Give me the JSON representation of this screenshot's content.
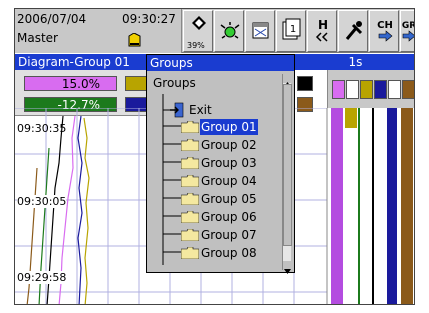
{
  "status": {
    "date": "2006/07/04",
    "time": "09:30:27",
    "user": "Master",
    "memory_percent": "39%"
  },
  "toolbar": {
    "buttons": [
      {
        "name": "display-switch-icon"
      },
      {
        "name": "alarm-icon"
      },
      {
        "name": "calendar-icon"
      },
      {
        "name": "screen-number-icon",
        "label": "1"
      },
      {
        "name": "history-icon",
        "label": "H"
      },
      {
        "name": "tools-icon"
      },
      {
        "name": "channel-icon",
        "label": "CH"
      },
      {
        "name": "group-icon",
        "label": "GR"
      }
    ]
  },
  "header": {
    "group_title": "Diagram-Group 01",
    "interval": "1s"
  },
  "values": [
    {
      "text": "15.0%"
    },
    {
      "text": "-12.7%"
    }
  ],
  "trend_times": [
    "09:30:35",
    "09:30:05",
    "09:29:58"
  ],
  "popup": {
    "title": "Groups",
    "root": "Groups",
    "exit": "Exit",
    "items": [
      "Group 01",
      "Group 02",
      "Group 03",
      "Group 04",
      "Group 05",
      "Group 06",
      "Group 07",
      "Group 08"
    ],
    "selected_index": 0
  },
  "colors": {
    "title_bar": "#1a3cd0",
    "toolbar": "#c8c8c8",
    "ch1": "#d86cf0",
    "ch2": "#1c7a1c",
    "ch3": "#b8a400",
    "ch4": "#1a1a9c",
    "ch5": "#000000",
    "ch6": "#8b5a1a"
  }
}
